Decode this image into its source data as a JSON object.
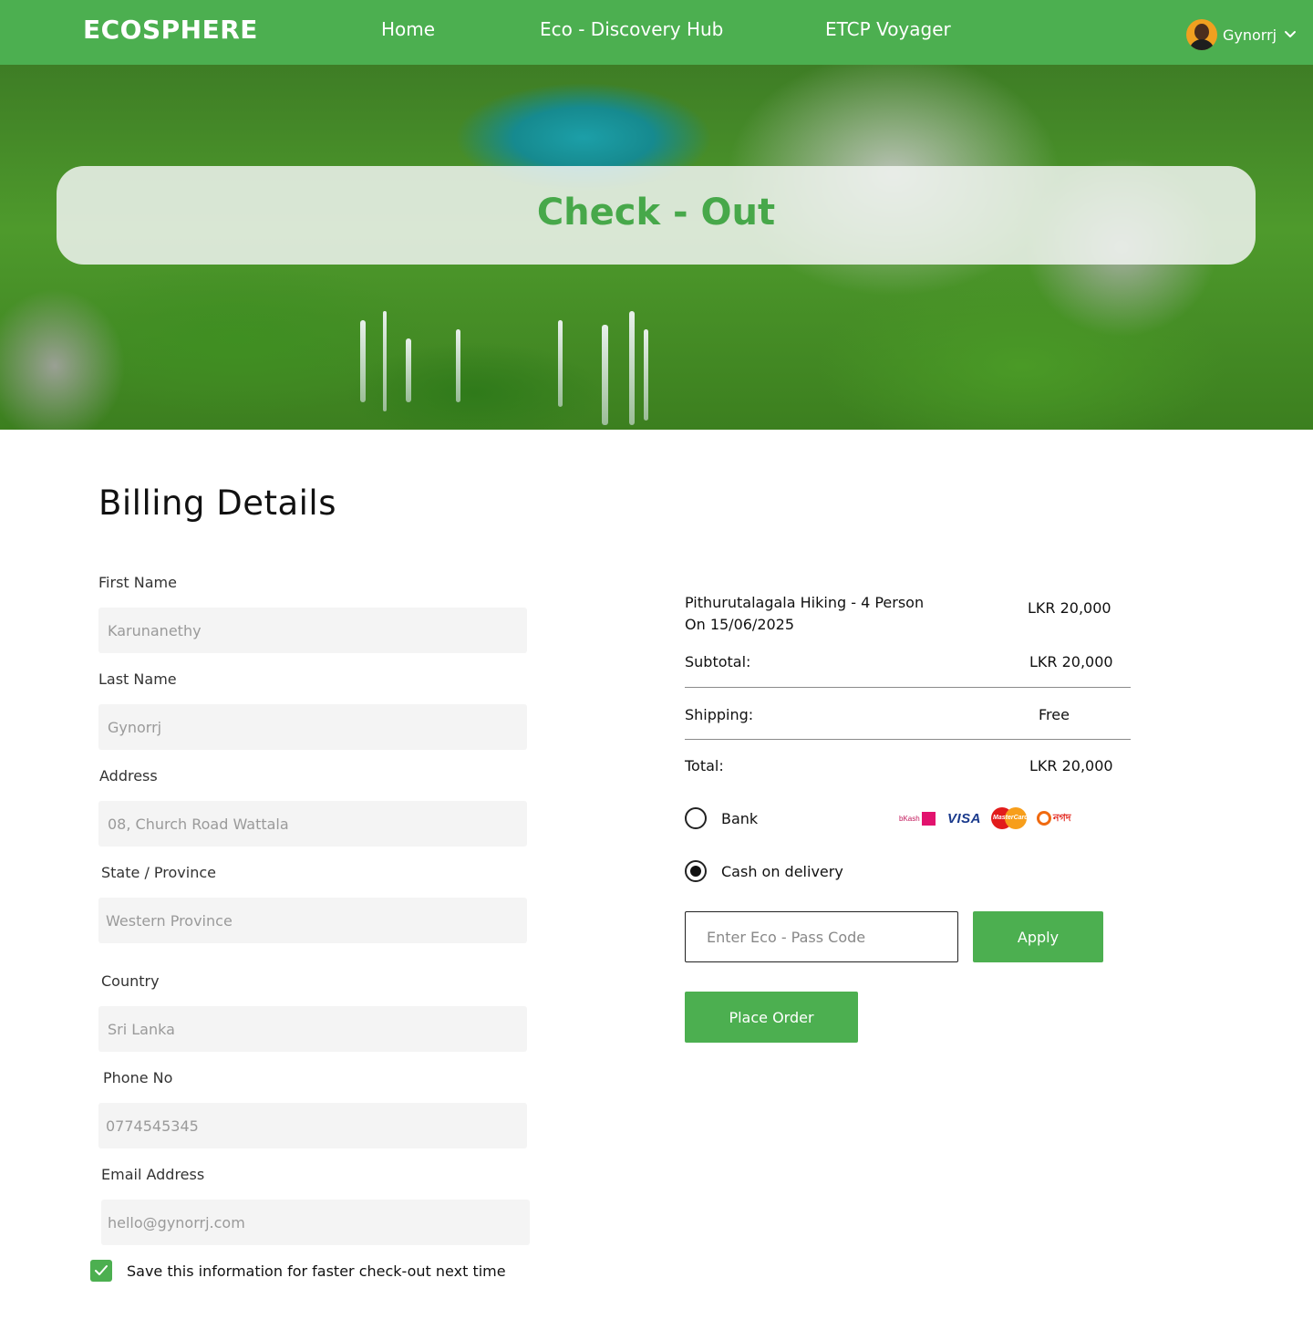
{
  "navbar": {
    "brand": "ECOSPHERE",
    "links": [
      "Home",
      "Eco - Discovery Hub",
      "ETCP Voyager"
    ],
    "user_name": "Gynorrj"
  },
  "hero": {
    "title": "Check - Out"
  },
  "billing": {
    "heading": "Billing Details",
    "fields": [
      {
        "label": "First Name",
        "placeholder": "Karunanethy"
      },
      {
        "label": "Last Name",
        "placeholder": "Gynorrj"
      },
      {
        "label": "Address",
        "placeholder": "08, Church Road Wattala"
      },
      {
        "label": "State / Province",
        "placeholder": "Western Province"
      },
      {
        "label": "Country",
        "placeholder": "Sri Lanka"
      },
      {
        "label": "Phone No",
        "placeholder": "0774545345"
      },
      {
        "label": "Email Address",
        "placeholder": "hello@gynorrj.com"
      }
    ],
    "save_info_label": "Save this information for faster check-out next time",
    "save_info_checked": true
  },
  "order": {
    "item_name": "Pithurutalagala Hiking - 4 Person",
    "item_date": "On 15/06/2025",
    "item_price": "LKR 20,000",
    "subtotal_label": "Subtotal:",
    "subtotal_value": "LKR 20,000",
    "shipping_label": "Shipping:",
    "shipping_value": "Free",
    "total_label": "Total:",
    "total_value": "LKR 20,000",
    "payment_options": [
      {
        "label": "Bank",
        "selected": false
      },
      {
        "label": "Cash on delivery",
        "selected": true
      }
    ],
    "payment_logos": {
      "bkash": "bKash",
      "visa": "VISA",
      "mastercard": "MasterCard",
      "nagad": "নগদ"
    },
    "code_placeholder": "Enter Eco - Pass Code",
    "apply_label": "Apply",
    "place_order_label": "Place Order"
  },
  "colors": {
    "brand_green": "#4CAF50",
    "title_green": "#47a84a",
    "input_bg": "#f4f4f4"
  }
}
